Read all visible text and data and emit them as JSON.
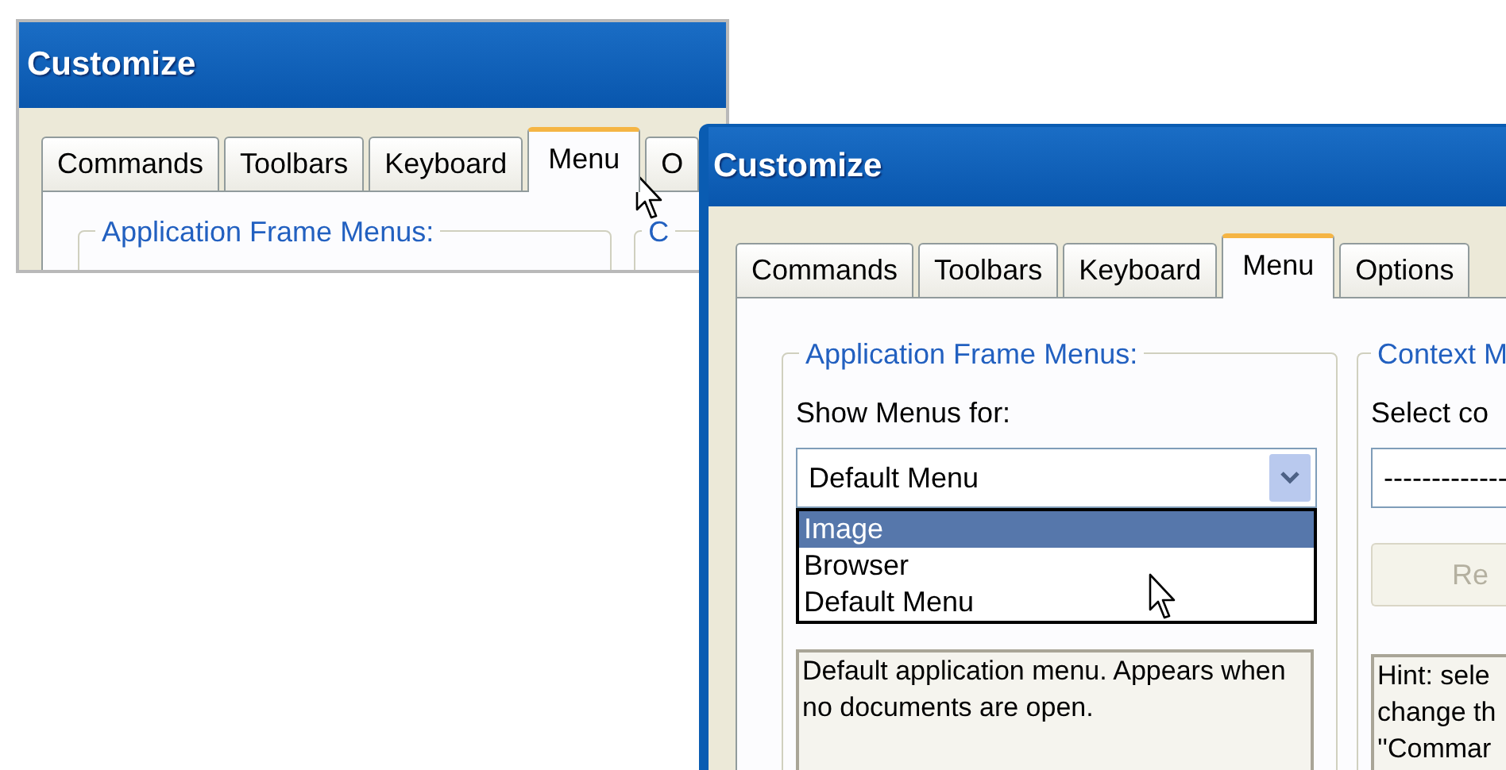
{
  "windows": [
    {
      "title": "Customize",
      "tabs": [
        {
          "label": "Commands",
          "selected": false
        },
        {
          "label": "Toolbars",
          "selected": false
        },
        {
          "label": "Keyboard",
          "selected": false
        },
        {
          "label": "Menu",
          "selected": true
        },
        {
          "label": "O",
          "selected": false
        }
      ],
      "groups": [
        {
          "title": "Application Frame Menus:"
        },
        {
          "title": "C"
        }
      ]
    },
    {
      "title": "Customize",
      "tabs": [
        {
          "label": "Commands",
          "selected": false
        },
        {
          "label": "Toolbars",
          "selected": false
        },
        {
          "label": "Keyboard",
          "selected": false
        },
        {
          "label": "Menu",
          "selected": true
        },
        {
          "label": "Options",
          "selected": false
        }
      ],
      "left_group": {
        "title": "Application Frame Menus:",
        "label": "Show Menus for:",
        "combo_value": "Default Menu",
        "dropdown_options": [
          {
            "label": "Image",
            "selected": true
          },
          {
            "label": "Browser",
            "selected": false
          },
          {
            "label": "Default Menu",
            "selected": false
          }
        ],
        "description": "Default application menu. Appears when no documents are open."
      },
      "right_group": {
        "title": "Context M",
        "label": "Select co",
        "combo_value": "-------------",
        "button": {
          "label": "Re",
          "disabled": true
        },
        "hint_lines": [
          "Hint: sele",
          "change th",
          "''Commar"
        ]
      }
    }
  ]
}
